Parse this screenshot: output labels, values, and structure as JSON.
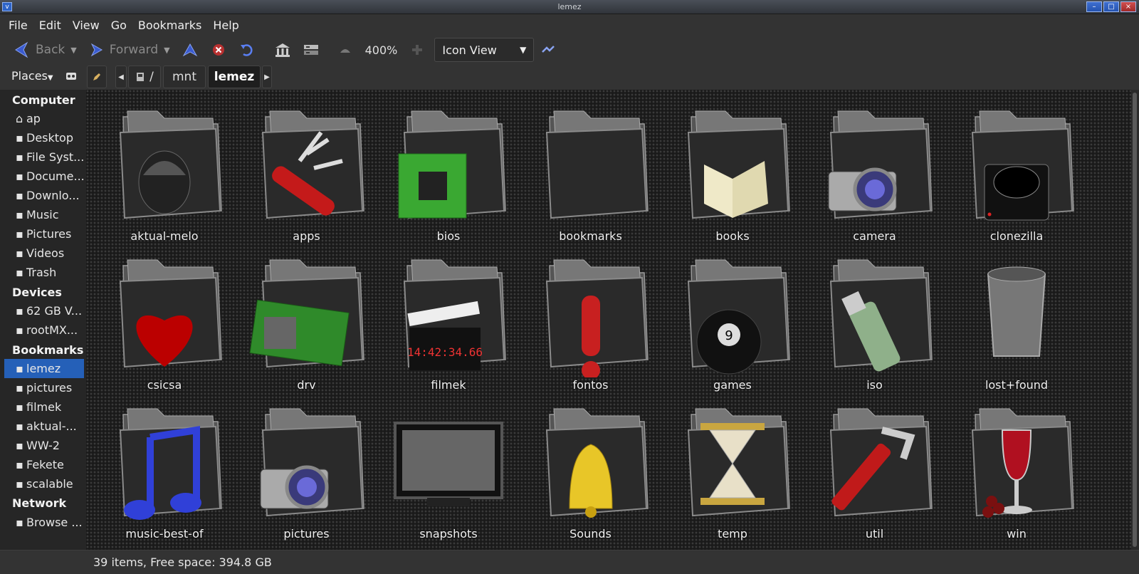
{
  "window": {
    "title": "lemez"
  },
  "menu": [
    "File",
    "Edit",
    "View",
    "Go",
    "Bookmarks",
    "Help"
  ],
  "toolbar": {
    "back_label": "Back",
    "forward_label": "Forward",
    "zoom": "400%",
    "view_mode": "Icon View",
    "icons": [
      "back-arrow-icon",
      "forward-arrow-icon",
      "up-icon",
      "stop-icon",
      "reload-icon",
      "home-icon",
      "computer-icon",
      "zoom-out-icon",
      "zoom-in-icon",
      "compact-view-icon"
    ]
  },
  "pathbar": {
    "places_label": "Places",
    "crumbs": [
      "/",
      "mnt",
      "lemez"
    ],
    "active": "lemez"
  },
  "sidebar": {
    "sections": [
      {
        "title": "Computer",
        "items": [
          "ap",
          "Desktop",
          "File Syst...",
          "Docume...",
          "Downlo...",
          "Music",
          "Pictures",
          "Videos",
          "Trash"
        ]
      },
      {
        "title": "Devices",
        "items": [
          "62 GB V...",
          "rootMX..."
        ]
      },
      {
        "title": "Bookmarks",
        "items": [
          "lemez",
          "pictures",
          "filmek",
          "aktual-...",
          "WW-2",
          "Fekete",
          "scalable"
        ]
      },
      {
        "title": "Network",
        "items": [
          "Browse ..."
        ]
      }
    ],
    "selected": "lemez"
  },
  "files": [
    {
      "name": "aktual-melo",
      "icon": "helmet-icon"
    },
    {
      "name": "apps",
      "icon": "swiss-knife-icon"
    },
    {
      "name": "bios",
      "icon": "circuit-chip-icon"
    },
    {
      "name": "bookmarks",
      "icon": "folder-icon"
    },
    {
      "name": "books",
      "icon": "open-book-icon"
    },
    {
      "name": "camera",
      "icon": "camera-icon"
    },
    {
      "name": "clonezilla",
      "icon": "hard-drive-icon"
    },
    {
      "name": "csicsa",
      "icon": "heart-icon"
    },
    {
      "name": "drv",
      "icon": "graphics-card-icon"
    },
    {
      "name": "filmek",
      "icon": "clapperboard-icon"
    },
    {
      "name": "fontos",
      "icon": "exclamation-icon"
    },
    {
      "name": "games",
      "icon": "billiard-ball-icon"
    },
    {
      "name": "iso",
      "icon": "usb-drive-icon"
    },
    {
      "name": "lost+found",
      "icon": "trash-bin-icon"
    },
    {
      "name": "music-best-of",
      "icon": "music-note-icon"
    },
    {
      "name": "pictures",
      "icon": "camera-icon"
    },
    {
      "name": "snapshots",
      "icon": "monitor-icon"
    },
    {
      "name": "Sounds",
      "icon": "bell-icon"
    },
    {
      "name": "temp",
      "icon": "hourglass-icon"
    },
    {
      "name": "util",
      "icon": "wrench-icon"
    },
    {
      "name": "win",
      "icon": "wine-glass-icon"
    }
  ],
  "status": {
    "text": "39 items, Free space: 394.8 GB"
  }
}
